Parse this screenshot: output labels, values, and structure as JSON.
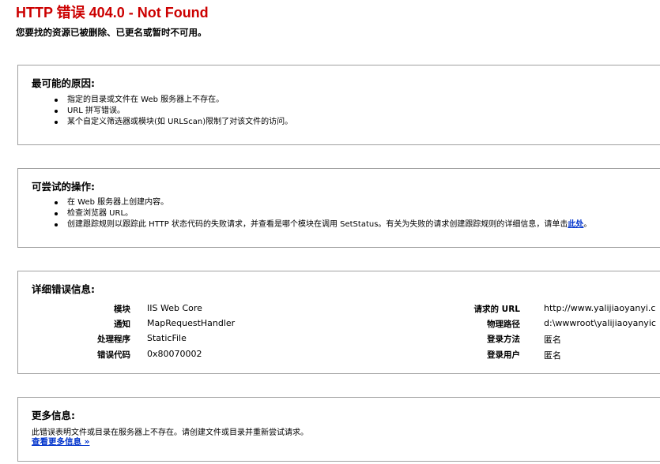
{
  "page": {
    "title": "HTTP 错误 404.0 - Not Found",
    "subtitle": "您要找的资源已被删除、已更名或暂时不可用。"
  },
  "likely_causes": {
    "heading": "最可能的原因:",
    "items": [
      "指定的目录或文件在 Web 服务器上不存在。",
      "URL 拼写错误。",
      "某个自定义筛选器或模块(如 URLScan)限制了对该文件的访问。"
    ]
  },
  "things_to_try": {
    "heading": "可尝试的操作:",
    "items": [
      "在 Web 服务器上创建内容。",
      "检查浏览器 URL。"
    ],
    "last_item_text": "创建跟踪规则以跟踪此 HTTP 状态代码的失败请求，并查看是哪个模块在调用 SetStatus。有关为失败的请求创建跟踪规则的详细信息，请单击",
    "last_item_link": "此处",
    "last_item_suffix": "。"
  },
  "details": {
    "heading": "详细错误信息:",
    "left": [
      {
        "label": "模块",
        "value": "IIS Web Core"
      },
      {
        "label": "通知",
        "value": "MapRequestHandler"
      },
      {
        "label": "处理程序",
        "value": "StaticFile"
      },
      {
        "label": "错误代码",
        "value": "0x80070002"
      }
    ],
    "right": [
      {
        "label": "请求的 URL",
        "value": "http://www.yalijiaoyanyi.c"
      },
      {
        "label": "物理路径",
        "value": "d:\\wwwroot\\yalijiaoyanyic"
      },
      {
        "label": "登录方法",
        "value": "匿名"
      },
      {
        "label": "登录用户",
        "value": "匿名"
      }
    ]
  },
  "more_info": {
    "heading": "更多信息:",
    "text": "此错误表明文件或目录在服务器上不存在。请创建文件或目录并重新尝试请求。",
    "link": "查看更多信息 »"
  },
  "colors": {
    "title": "#CC0000",
    "link": "#0033CC",
    "border": "#A0A0A0"
  }
}
